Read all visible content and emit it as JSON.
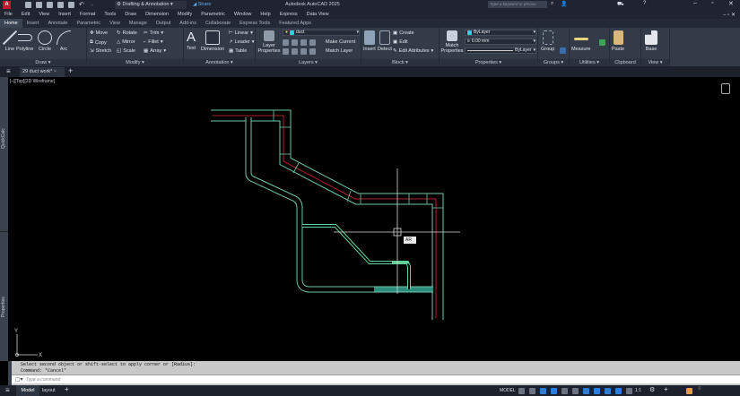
{
  "title_bar": {
    "app_title": "Autodesk AutoCAD 2025",
    "workspace": "Drafting & Annotation",
    "share": "Share",
    "search_placeholder": "Type a keyword or phrase",
    "app_badge": "A"
  },
  "menu": [
    "File",
    "Edit",
    "View",
    "Insert",
    "Format",
    "Tools",
    "Draw",
    "Dimension",
    "Modify",
    "Parametric",
    "Window",
    "Help",
    "Express",
    "Data View"
  ],
  "ribbon_tabs": [
    "Home",
    "Insert",
    "Annotate",
    "Parametric",
    "View",
    "Manage",
    "Output",
    "Add-ins",
    "Collaborate",
    "Express Tools",
    "Featured Apps"
  ],
  "panels": {
    "draw": {
      "label": "Draw",
      "items": [
        "Line",
        "Polyline",
        "Circle",
        "Arc"
      ]
    },
    "modify": {
      "label": "Modify",
      "items": [
        "Move",
        "Rotate",
        "Trim",
        "Copy",
        "Mirror",
        "Fillet",
        "Stretch",
        "Scale",
        "Array"
      ]
    },
    "annotation": {
      "label": "Annotation",
      "items": [
        "Text",
        "Dimension",
        "Linear",
        "Leader",
        "Table"
      ]
    },
    "layers": {
      "label": "Layers",
      "layer_properties": "Layer Properties",
      "current_layer": "duct",
      "make_current": "Make Current",
      "match_layer": "Match Layer"
    },
    "block": {
      "label": "Block",
      "items": [
        "Insert",
        "Detect",
        "Create",
        "Edit",
        "Edit Attributes"
      ]
    },
    "properties": {
      "label": "Properties",
      "match": "Match Properties",
      "color": "ByLayer",
      "lineweight": "0.00 mm",
      "linetype": "ByLayer"
    },
    "groups": {
      "label": "Groups",
      "group": "Group"
    },
    "utilities": {
      "label": "Utilities",
      "measure": "Measure"
    },
    "clipboard": {
      "label": "Clipboard",
      "paste": "Paste"
    },
    "view": {
      "label": "View",
      "base": "Base"
    }
  },
  "doc_tab": "29 duct work*",
  "viewport": {
    "label": "[–][Top][2D Wireframe]",
    "cursor_tooltip": "AR",
    "ucs_x": "X",
    "ucs_y": "Y"
  },
  "palettes": [
    "QuickCalc",
    "Properties"
  ],
  "command": {
    "history": [
      "Select second object or shift-select to apply corner or [Radius]:",
      "Command: *Cancel*"
    ],
    "placeholder": "Type a command"
  },
  "layout_tabs": [
    "Model",
    "layout"
  ],
  "status": {
    "mode": "MODEL",
    "scale": "1:1"
  },
  "colors": {
    "duct": "#6fc9b0",
    "center": "#b0202a",
    "pipe": "#5fd39a",
    "accent": "#2b7fd6"
  }
}
